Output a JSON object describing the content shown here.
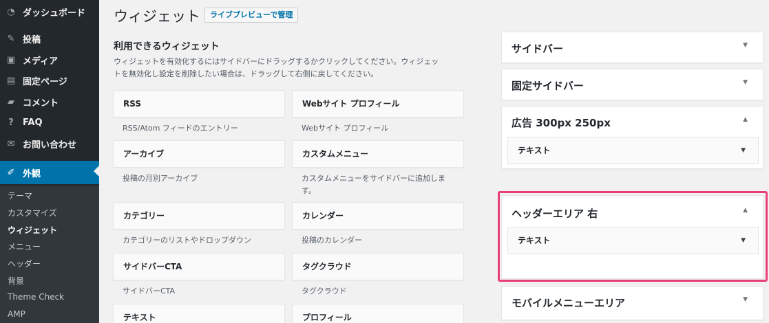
{
  "sidebar": {
    "items": [
      {
        "label": "ダッシュボード",
        "icon": "dashboard-icon"
      },
      {
        "label": "投稿",
        "icon": "pin-icon"
      },
      {
        "label": "メディア",
        "icon": "media-icon"
      },
      {
        "label": "固定ページ",
        "icon": "page-icon"
      },
      {
        "label": "コメント",
        "icon": "comment-icon"
      },
      {
        "label": "FAQ",
        "icon": "help-icon"
      },
      {
        "label": "お問い合わせ",
        "icon": "mail-icon"
      },
      {
        "label": "外観",
        "icon": "brush-icon"
      }
    ],
    "submenu": [
      "テーマ",
      "カスタマイズ",
      "ウィジェット",
      "メニュー",
      "ヘッダー",
      "背景",
      "Theme Check",
      "AMP"
    ]
  },
  "header": {
    "title": "ウィジェット",
    "live_preview": "ライブプレビューで管理"
  },
  "available": {
    "title": "利用できるウィジェット",
    "desc_line1": "ウィジェットを有効化するにはサイドバーにドラッグするかクリックしてください。ウィジェッ",
    "desc_line2": "トを無効化し設定を削除したい場合は、ドラッグして右側に戻してください。",
    "widgets": [
      {
        "title": "RSS",
        "desc": "RSS/Atom フィードのエントリー"
      },
      {
        "title": "Webサイト プロフィール",
        "desc": "Webサイト プロフィール"
      },
      {
        "title": "アーカイブ",
        "desc": "投稿の月別アーカイブ"
      },
      {
        "title": "カスタムメニュー",
        "desc1": "カスタムメニューをサイドバーに追加しま",
        "desc2": "す。"
      },
      {
        "title": "カテゴリー",
        "desc": "カテゴリーのリストやドロップダウン"
      },
      {
        "title": "カレンダー",
        "desc": "投稿のカレンダー"
      },
      {
        "title": "サイドバーCTA",
        "desc": "サイドバーCTA"
      },
      {
        "title": "タグクラウド",
        "desc": "タグクラウド"
      },
      {
        "title": "テキスト"
      },
      {
        "title": "プロフィール"
      }
    ]
  },
  "sidebars": [
    {
      "title": "サイドバー"
    },
    {
      "title": "固定サイドバー"
    },
    {
      "title": "広告 300px 250px",
      "widget": "テキスト"
    },
    {
      "title": "ヘッダーエリア 右",
      "widget": "テキスト"
    },
    {
      "title": "モバイルメニューエリア"
    }
  ],
  "colors": {
    "accent": "#0073aa",
    "highlight": "#e83e7a",
    "sidebar_bg": "#23282d"
  }
}
